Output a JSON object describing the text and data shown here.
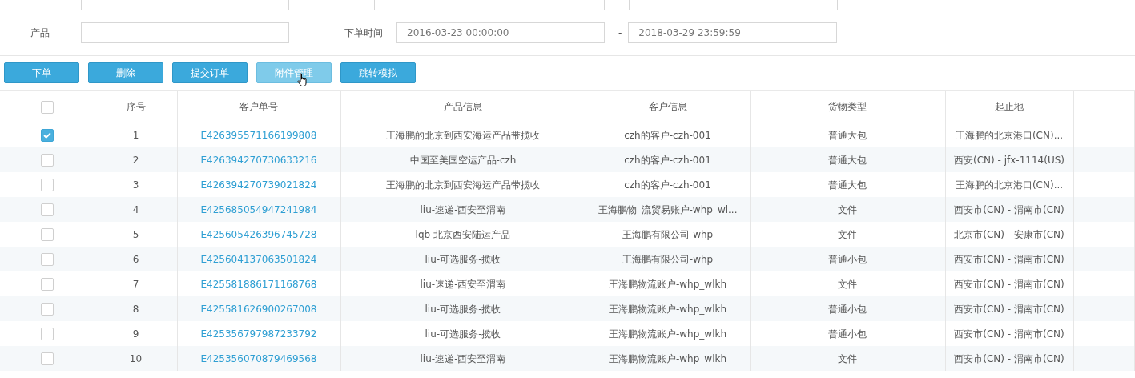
{
  "filters": [
    {
      "label": "产品",
      "kind": "text"
    },
    {
      "label": "下单时间",
      "value": "2016-03-23 00:00:00",
      "kind": "range",
      "separator": "-",
      "value_end": "2018-03-29 23:59:59"
    }
  ],
  "buttons": [
    {
      "label": "下单",
      "hovered": false
    },
    {
      "label": "删除",
      "hovered": false
    },
    {
      "label": "提交订单",
      "hovered": false
    },
    {
      "label": "附件管理",
      "hovered": true
    },
    {
      "label": "跳转模拟",
      "hovered": false
    }
  ],
  "table": {
    "select_all": false,
    "columns": [
      "序号",
      "客户单号",
      "产品信息",
      "客户信息",
      "货物类型",
      "起止地"
    ],
    "rows": [
      {
        "selected": true,
        "cells": [
          "1",
          "E426395571166199808",
          "王海鹏的北京到西安海运产品带揽收",
          "czh的客户-czh-001",
          "普通大包",
          "王海鹏的北京港口(CN)..."
        ]
      },
      {
        "selected": false,
        "cells": [
          "2",
          "E426394270730633216",
          "中国至美国空运产品-czh",
          "czh的客户-czh-001",
          "普通大包",
          "西安(CN) - jfx-1114(US)"
        ]
      },
      {
        "selected": false,
        "cells": [
          "3",
          "E426394270739021824",
          "王海鹏的北京到西安海运产品带揽收",
          "czh的客户-czh-001",
          "普通大包",
          "王海鹏的北京港口(CN)..."
        ]
      },
      {
        "selected": false,
        "cells": [
          "4",
          "E425685054947241984",
          "liu-速递-西安至渭南",
          "王海鹏物_流贸易账户-whp_wl...",
          "文件",
          "西安市(CN) - 渭南市(CN)"
        ]
      },
      {
        "selected": false,
        "cells": [
          "5",
          "E425605426396745728",
          "lqb-北京西安陆运产品",
          "王海鹏有限公司-whp",
          "文件",
          "北京市(CN) - 安康市(CN)"
        ]
      },
      {
        "selected": false,
        "cells": [
          "6",
          "E425604137063501824",
          "liu-可选服务-揽收",
          "王海鹏有限公司-whp",
          "普通小包",
          "西安市(CN) - 渭南市(CN)"
        ]
      },
      {
        "selected": false,
        "cells": [
          "7",
          "E425581886171168768",
          "liu-速递-西安至渭南",
          "王海鹏物流账户-whp_wlkh",
          "文件",
          "西安市(CN) - 渭南市(CN)"
        ]
      },
      {
        "selected": false,
        "cells": [
          "8",
          "E425581626900267008",
          "liu-可选服务-揽收",
          "王海鹏物流账户-whp_wlkh",
          "普通小包",
          "西安市(CN) - 渭南市(CN)"
        ]
      },
      {
        "selected": false,
        "cells": [
          "9",
          "E425356797987233792",
          "liu-可选服务-揽收",
          "王海鹏物流账户-whp_wlkh",
          "普通小包",
          "西安市(CN) - 渭南市(CN)"
        ]
      },
      {
        "selected": false,
        "cells": [
          "10",
          "E425356070879469568",
          "liu-速递-西安至渭南",
          "王海鹏物流账户-whp_wlkh",
          "文件",
          "西安市(CN) - 渭南市(CN)"
        ]
      }
    ]
  }
}
